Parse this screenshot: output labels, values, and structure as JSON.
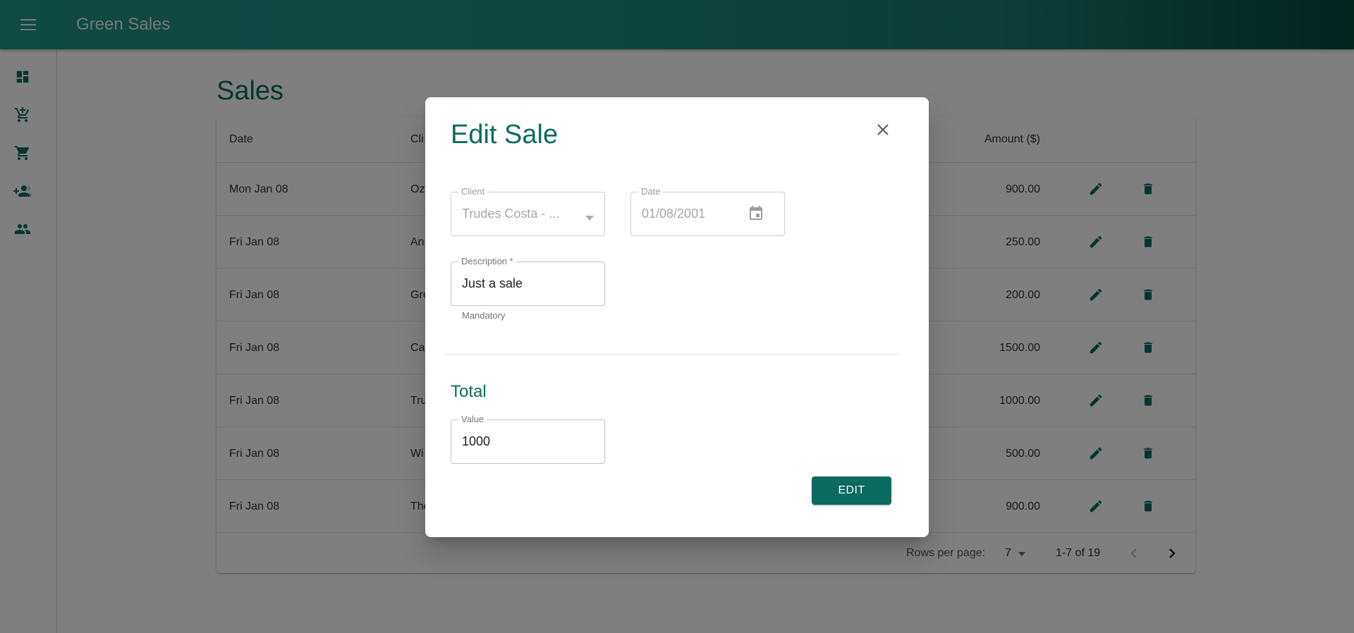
{
  "app": {
    "title": "Green Sales"
  },
  "sidebar": {
    "items": [
      {
        "icon": "dashboard-icon"
      },
      {
        "icon": "add-to-cart-icon"
      },
      {
        "icon": "shopping-cart-icon"
      },
      {
        "icon": "add-client-icon"
      },
      {
        "icon": "clients-icon"
      }
    ]
  },
  "main": {
    "title": "Sales",
    "table": {
      "headers": {
        "date": "Date",
        "client": "Cli",
        "amount": "Amount ($)"
      },
      "rows": [
        {
          "date": "Mon Jan 08",
          "client": "Oz",
          "amount": "900.00"
        },
        {
          "date": "Fri Jan 08",
          "client": "An",
          "amount": "250.00"
        },
        {
          "date": "Fri Jan 08",
          "client": "Gre",
          "amount": "200.00"
        },
        {
          "date": "Fri Jan 08",
          "client": "Ca",
          "amount": "1500.00"
        },
        {
          "date": "Fri Jan 08",
          "client": "Tru",
          "amount": "1000.00"
        },
        {
          "date": "Fri Jan 08",
          "client": "Wi",
          "amount": "500.00"
        },
        {
          "date": "Fri Jan 08",
          "client": "The",
          "amount": "900.00"
        }
      ],
      "footer": {
        "rows_per_page_label": "Rows per page:",
        "rows_per_page_value": "7",
        "range": "1-7 of 19"
      }
    }
  },
  "dialog": {
    "title": "Edit Sale",
    "client": {
      "label": "Client",
      "value": "Trudes Costa - ..."
    },
    "date": {
      "label": "Date",
      "value": "01/08/2001"
    },
    "description": {
      "label": "Description",
      "required_mark": " *",
      "value": "Just a sale",
      "helper": "Mandatory"
    },
    "total_title": "Total",
    "value": {
      "label": "Value",
      "value": "1000"
    },
    "submit_label": "EDIT"
  },
  "colors": {
    "primary": "#0b6b5e",
    "appbar_start": "#1f9486",
    "appbar_end": "#044a3d"
  }
}
